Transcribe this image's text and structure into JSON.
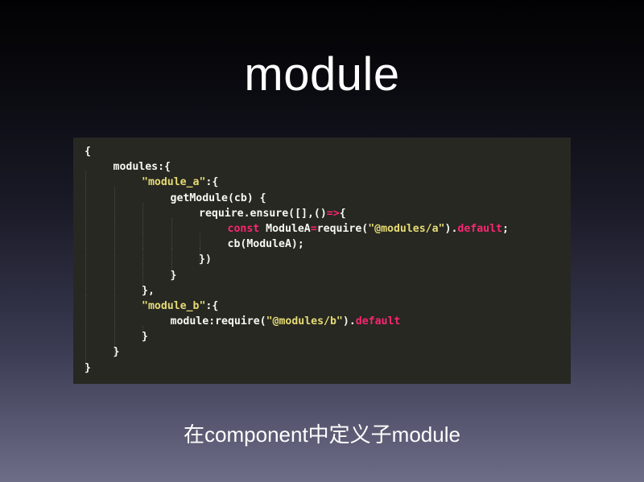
{
  "slide": {
    "title": "module",
    "caption": "在component中定义子module"
  },
  "code": {
    "lines": [
      {
        "indent": 0,
        "tokens": [
          {
            "t": "{",
            "c": "plain"
          }
        ]
      },
      {
        "indent": 1,
        "tokens": [
          {
            "t": "modules:{",
            "c": "plain"
          }
        ]
      },
      {
        "indent": 2,
        "tokens": [
          {
            "t": "\"module_a\"",
            "c": "str"
          },
          {
            "t": ":{",
            "c": "plain"
          }
        ]
      },
      {
        "indent": 3,
        "tokens": [
          {
            "t": "getModule(cb) {",
            "c": "plain"
          }
        ]
      },
      {
        "indent": 4,
        "tokens": [
          {
            "t": "require.ensure([],()",
            "c": "plain"
          },
          {
            "t": "=>",
            "c": "kw"
          },
          {
            "t": "{",
            "c": "plain"
          }
        ]
      },
      {
        "indent": 5,
        "tokens": [
          {
            "t": "const",
            "c": "kw"
          },
          {
            "t": " ModuleA",
            "c": "plain"
          },
          {
            "t": "=",
            "c": "kw"
          },
          {
            "t": "require(",
            "c": "plain"
          },
          {
            "t": "\"@modules/a\"",
            "c": "str"
          },
          {
            "t": ").",
            "c": "plain"
          },
          {
            "t": "default",
            "c": "kw"
          },
          {
            "t": ";",
            "c": "plain"
          }
        ]
      },
      {
        "indent": 5,
        "tokens": [
          {
            "t": "cb(ModuleA);",
            "c": "plain"
          }
        ]
      },
      {
        "indent": 4,
        "tokens": [
          {
            "t": "})",
            "c": "plain"
          }
        ]
      },
      {
        "indent": 3,
        "tokens": [
          {
            "t": "}",
            "c": "plain"
          }
        ]
      },
      {
        "indent": 2,
        "tokens": [
          {
            "t": "},",
            "c": "plain"
          }
        ]
      },
      {
        "indent": 2,
        "tokens": [
          {
            "t": "\"module_b\"",
            "c": "str"
          },
          {
            "t": ":{",
            "c": "plain"
          }
        ]
      },
      {
        "indent": 3,
        "tokens": [
          {
            "t": "module:require(",
            "c": "plain"
          },
          {
            "t": "\"@modules/b\"",
            "c": "str"
          },
          {
            "t": ").",
            "c": "plain"
          },
          {
            "t": "default",
            "c": "kw"
          }
        ]
      },
      {
        "indent": 2,
        "tokens": [
          {
            "t": "}",
            "c": "plain"
          }
        ]
      },
      {
        "indent": 1,
        "tokens": [
          {
            "t": "}",
            "c": "plain"
          }
        ]
      },
      {
        "indent": 0,
        "tokens": [
          {
            "t": "}",
            "c": "plain"
          }
        ]
      }
    ]
  }
}
